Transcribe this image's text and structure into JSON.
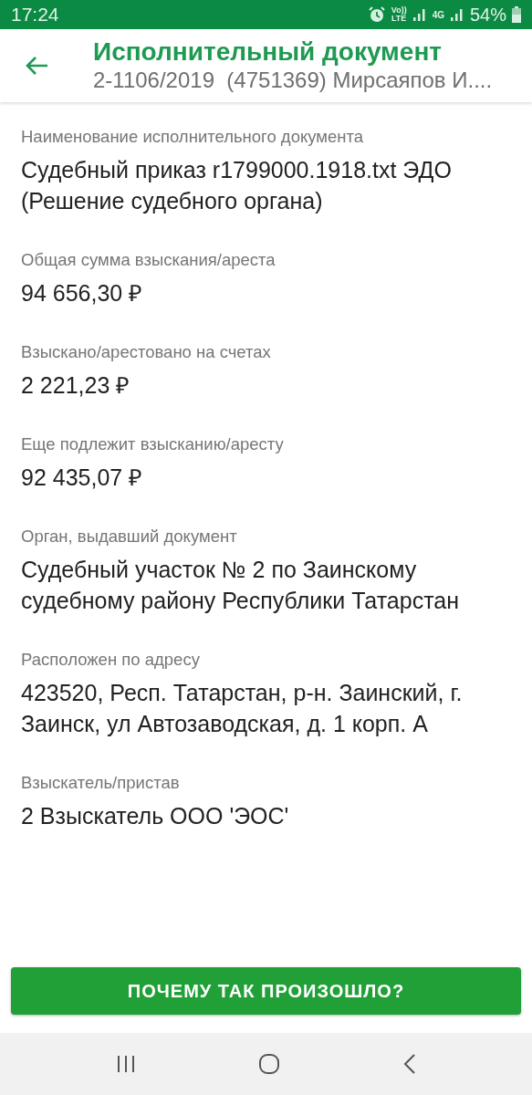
{
  "status_bar": {
    "time": "17:24",
    "volte_top": "Vo))",
    "volte_bottom": "LTE",
    "network": "4G",
    "battery": "54%"
  },
  "header": {
    "title": "Исполнительный документ",
    "subtitle": "2-1106/2019  (4751369) Мирсаяпов И...."
  },
  "fields": [
    {
      "label": "Наименование исполнительного документа",
      "value": "Судебный приказ r1799000.1918.txt ЭДО (Решение судебного органа)"
    },
    {
      "label": "Общая сумма взыскания/ареста",
      "value": "94 656,30 ₽"
    },
    {
      "label": "Взыскано/арестовано на счетах",
      "value": "2 221,23 ₽"
    },
    {
      "label": "Еще подлежит взысканию/аресту",
      "value": "92 435,07 ₽"
    },
    {
      "label": "Орган, выдавший документ",
      "value": "Судебный участок № 2 по Заинскому судебному району Республики Татарстан"
    },
    {
      "label": "Расположен по адресу",
      "value": "423520, Респ. Татарстан, р-н. Заинский, г. Заинск, ул Автозаводская, д. 1 корп. А"
    },
    {
      "label": "Взыскатель/пристав",
      "value": "2 Взыскатель ООО 'ЭОС'"
    }
  ],
  "action_button": "ПОЧЕМУ ТАК ПРОИЗОШЛО?"
}
